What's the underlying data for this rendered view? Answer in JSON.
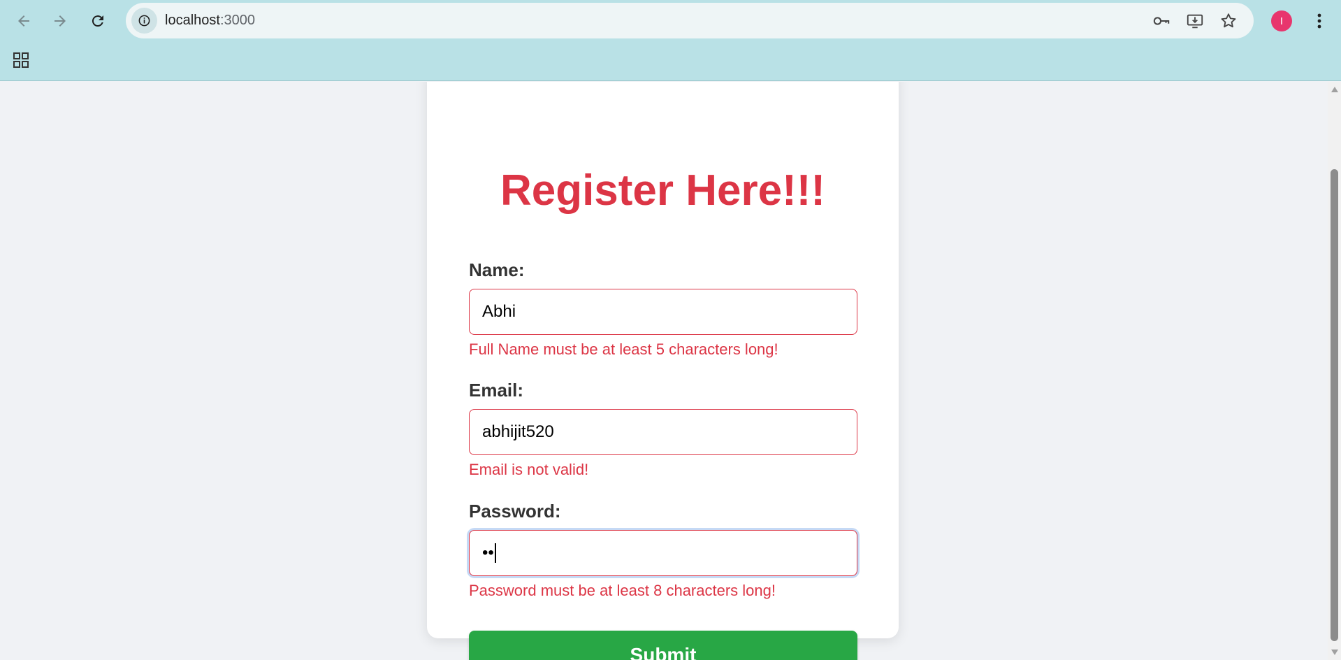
{
  "browser": {
    "url_host": "localhost",
    "url_port": ":3000",
    "profile_initial": "I",
    "icons": {
      "back": "arrow-left-icon",
      "forward": "arrow-right-icon",
      "reload": "reload-icon",
      "site_info": "info-icon",
      "passwords": "key-icon",
      "install": "install-app-icon",
      "bookmark": "star-icon",
      "menu": "kebab-menu-icon",
      "apps": "apps-grid-icon"
    }
  },
  "form": {
    "title": "Register Here!!!",
    "fields": [
      {
        "label": "Name:",
        "value": "Abhi",
        "error": "Full Name must be at least 5 characters long!"
      },
      {
        "label": "Email:",
        "value": "abhijit520",
        "error": "Email is not valid!"
      },
      {
        "label": "Password:",
        "value": "••",
        "error": "Password must be at least 8 characters long!"
      }
    ],
    "submit_label": "Submit"
  },
  "colors": {
    "accent_red": "#dc3545",
    "submit_green": "#28a745",
    "chrome_bg": "#b9e1e6"
  }
}
